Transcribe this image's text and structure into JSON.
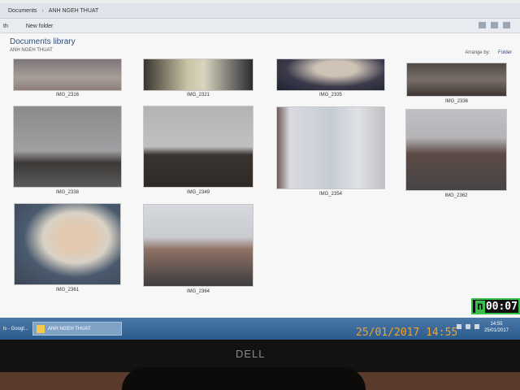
{
  "window": {
    "breadcrumb_root": "Documents",
    "breadcrumb_folder": "ANH NGEH THUAT"
  },
  "toolbar": {
    "share_label": "th",
    "new_folder_label": "New folder"
  },
  "library": {
    "title": "Documents library",
    "subtitle": "ANH NGEH THUAT",
    "arrange_label": "Arrange by:",
    "arrange_value": "Folder"
  },
  "thumbnails": [
    {
      "name": "IMG_2316",
      "icon": "photo-sky"
    },
    {
      "name": "IMG_2321",
      "icon": "photo-person"
    },
    {
      "name": "IMG_2335",
      "icon": "photo-scarf"
    },
    {
      "name": "IMG_2336",
      "icon": "photo-street"
    },
    {
      "name": "IMG_2338",
      "icon": "photo-trees"
    },
    {
      "name": "IMG_2349",
      "icon": "photo-building"
    },
    {
      "name": "IMG_2354",
      "icon": "photo-map"
    },
    {
      "name": "IMG_2362",
      "icon": "photo-street"
    },
    {
      "name": "IMG_2361",
      "icon": "photo-portrait"
    },
    {
      "name": "IMG_2364",
      "icon": "photo-street"
    }
  ],
  "taskbar": {
    "item1": "ls - Googl...",
    "item2": "ANH NGEH THUAT",
    "time": "14:55",
    "date": "25/01/2017"
  },
  "monitor": {
    "brand": "DELL"
  },
  "overlays": {
    "timer_prefix": "n",
    "timer": "00:07",
    "date_stamp": "25/01/2017",
    "time_stamp": "14:55"
  },
  "colors": {
    "taskbar": "#2b5b8d",
    "date_stamp": "#f2a32a",
    "timer_border": "#36c04a"
  }
}
